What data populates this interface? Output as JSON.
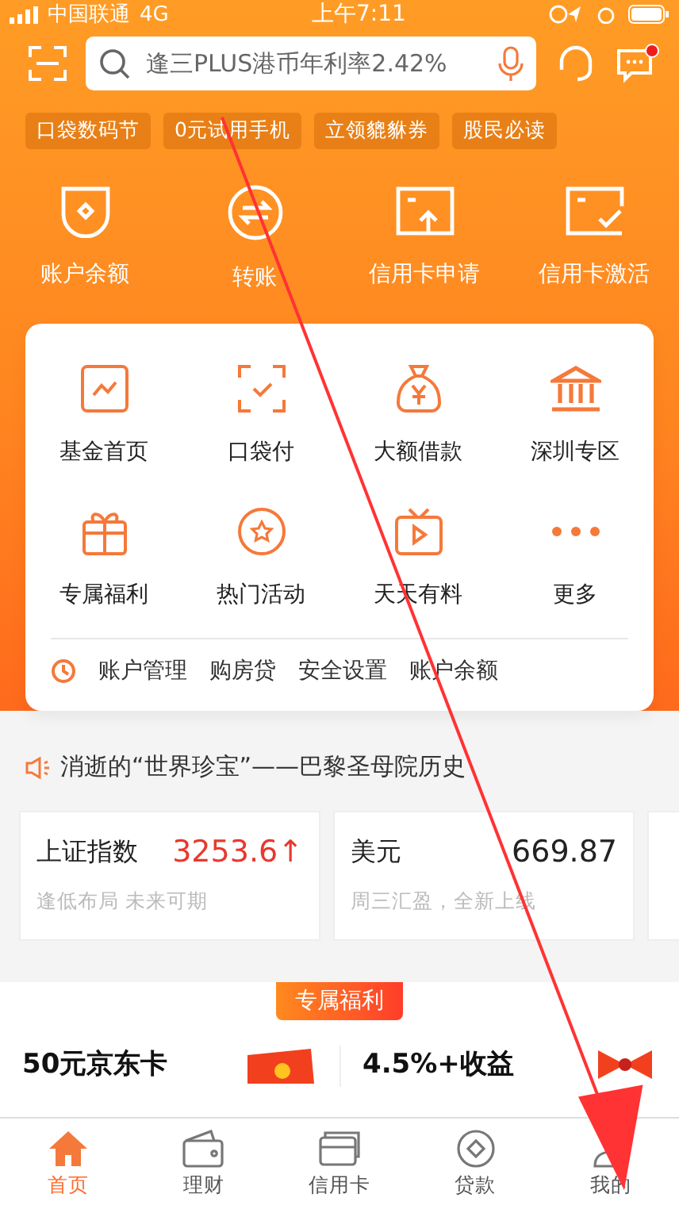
{
  "status_bar": {
    "carrier": "中国联通",
    "network": "4G",
    "time": "上午7:11"
  },
  "search": {
    "placeholder": "逢三PLUS港币年利率2.42%",
    "notification_dot": true
  },
  "chips": [
    "口袋数码节",
    "0元试用手机",
    "立领貔貅券",
    "股民必读"
  ],
  "quick_actions": [
    {
      "label": "账户余额"
    },
    {
      "label": "转账"
    },
    {
      "label": "信用卡申请"
    },
    {
      "label": "信用卡激活"
    }
  ],
  "services": [
    {
      "label": "基金首页"
    },
    {
      "label": "口袋付"
    },
    {
      "label": "大额借款"
    },
    {
      "label": "深圳专区"
    },
    {
      "label": "专属福利"
    },
    {
      "label": "热门活动"
    },
    {
      "label": "天天有料"
    },
    {
      "label": "更多"
    }
  ],
  "recent_links": [
    "账户管理",
    "购房贷",
    "安全设置",
    "账户余额"
  ],
  "notice": "消逝的“世界珍宝”——巴黎圣母院历史",
  "markets": [
    {
      "name": "上证指数",
      "value": "3253.6↑",
      "rising": true,
      "subtitle": "逢低布局 未来可期"
    },
    {
      "name": "美元",
      "value": "669.87",
      "rising": false,
      "subtitle": "周三汇盈，全新上线"
    }
  ],
  "section_badge": "专属福利",
  "promos": [
    {
      "title": "50元京东卡"
    },
    {
      "title": "4.5%+收益"
    }
  ],
  "tabs": [
    {
      "label": "首页",
      "selected": true
    },
    {
      "label": "理财",
      "selected": false
    },
    {
      "label": "信用卡",
      "selected": false
    },
    {
      "label": "贷款",
      "selected": false
    },
    {
      "label": "我的",
      "selected": false
    }
  ]
}
